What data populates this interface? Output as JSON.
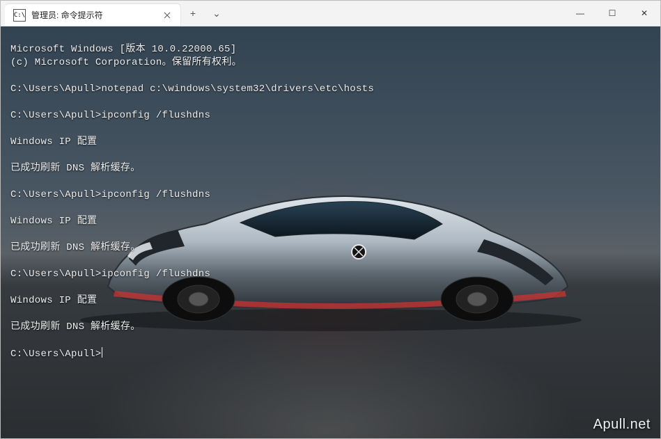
{
  "tab": {
    "icon_label": "C:\\",
    "title": "管理员: 命令提示符"
  },
  "window_controls": {
    "new_tab": "+",
    "dropdown": "⌄",
    "minimize": "—",
    "maximize": "☐",
    "close": "✕"
  },
  "watermark": "Apull.net",
  "terminal": {
    "lines": [
      "Microsoft Windows [版本 10.0.22000.65]",
      "(c) Microsoft Corporation。保留所有权利。",
      "",
      "C:\\Users\\Apull>notepad c:\\windows\\system32\\drivers\\etc\\hosts",
      "",
      "C:\\Users\\Apull>ipconfig /flushdns",
      "",
      "Windows IP 配置",
      "",
      "已成功刷新 DNS 解析缓存。",
      "",
      "C:\\Users\\Apull>ipconfig /flushdns",
      "",
      "Windows IP 配置",
      "",
      "已成功刷新 DNS 解析缓存。",
      "",
      "C:\\Users\\Apull>ipconfig /flushdns",
      "",
      "Windows IP 配置",
      "",
      "已成功刷新 DNS 解析缓存。",
      "",
      "C:\\Users\\Apull>"
    ],
    "show_cursor_after_last_line": true
  }
}
